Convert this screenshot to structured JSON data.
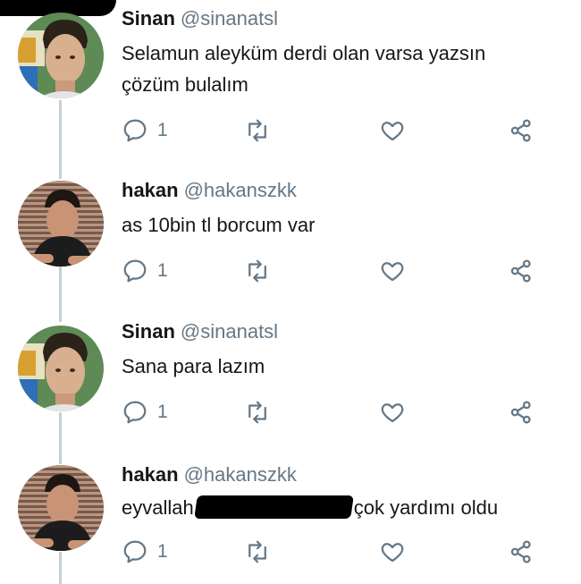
{
  "tweets": [
    {
      "name": "Sinan",
      "handle": "@sinanatsl",
      "text_line1": "Selamun aleyküm derdi olan varsa yazsın",
      "text_line2": "çözüm bulalım",
      "reply_count": "1"
    },
    {
      "name": "hakan",
      "handle": "@hakanszkk",
      "text_line1": "as 10bin tl borcum var",
      "reply_count": "1"
    },
    {
      "name": "Sinan",
      "handle": "@sinanatsl",
      "text_line1": "Sana para lazım",
      "reply_count": "1"
    },
    {
      "name": "hakan",
      "handle": "@hakanszkk",
      "text_before": "eyvallah",
      "text_after": "çok yardımı oldu",
      "reply_count": "1"
    }
  ],
  "icons": {
    "reply": "reply-icon",
    "retweet": "retweet-icon",
    "like": "heart-icon",
    "share": "share-icon"
  },
  "colors": {
    "icon": "#657786",
    "thread_line": "#c4cfd6",
    "redaction": "#000000"
  }
}
